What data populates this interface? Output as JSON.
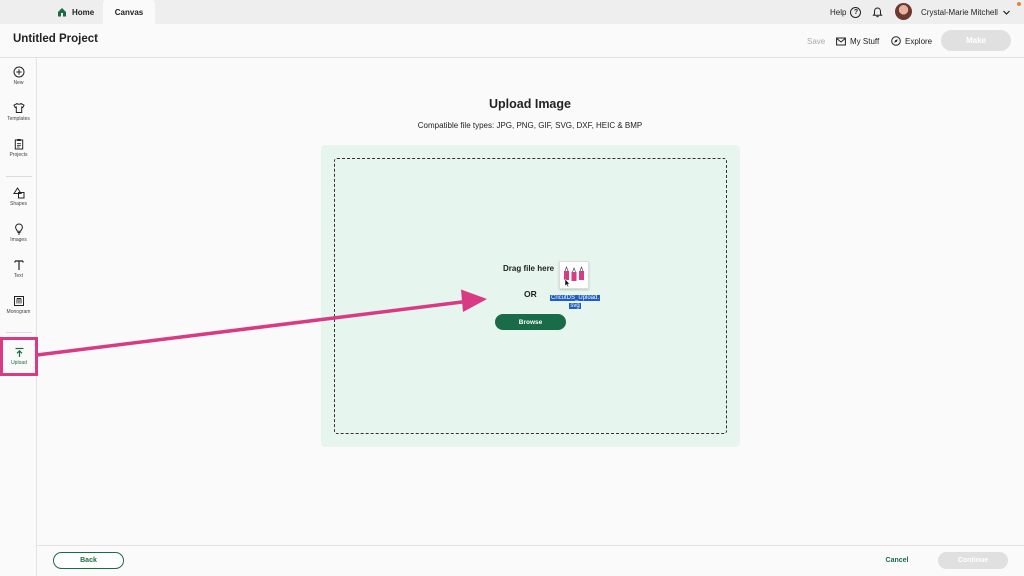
{
  "tabs": {
    "home": "Home",
    "canvas": "Canvas"
  },
  "topbar": {
    "help": "Help",
    "help_glyph": "?",
    "user_name": "Crystal-Marie Mitchell"
  },
  "header": {
    "project_title": "Untitled Project",
    "save": "Save",
    "my_stuff": "My Stuff",
    "explore": "Explore",
    "make": "Make"
  },
  "sidebar": {
    "new": "New",
    "templates": "Templates",
    "projects": "Projects",
    "shapes": "Shapes",
    "images": "Images",
    "text": "Text",
    "monogram": "Monogram",
    "upload": "Upload"
  },
  "upload": {
    "title": "Upload Image",
    "file_types": "Compatible file types:  JPG, PNG, GIF, SVG, DXF, HEIC & BMP",
    "drag": "Drag file here",
    "or": "OR",
    "browse": "Browse",
    "dragged_file_line1": "CricutDS_Upload.",
    "dragged_file_line2": "svg"
  },
  "footer": {
    "back": "Back",
    "cancel": "Cancel",
    "continue": "Continue"
  },
  "colors": {
    "brand_green": "#1a6b47",
    "highlight_pink": "#d93a84",
    "dropzone": "#e6f6ef"
  },
  "icons": [
    "home-icon",
    "help-icon",
    "bell-icon",
    "chevron-down-icon",
    "mail-icon",
    "compass-icon",
    "plus-circle-icon",
    "shirt-icon",
    "clipboard-icon",
    "shapes-icon",
    "lightbulb-icon",
    "text-icon",
    "monogram-icon",
    "upload-icon"
  ]
}
